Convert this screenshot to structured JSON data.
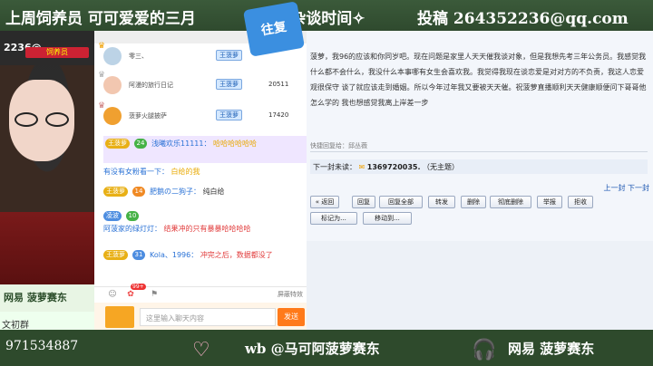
{
  "banner": {
    "left": "上周饲养员 可可爱爱的三月",
    "middle": "✧夜话杂谈时间✧",
    "right": "投稿 264352236@qq.com"
  },
  "webcam": {
    "overlay_text": "2236@",
    "badge": "饲养员",
    "strip_text": "网易 菠萝赛东",
    "bottom_text": "文初群"
  },
  "chat": {
    "ranking": [
      {
        "name": "零三、",
        "badge": "王菠萝",
        "score": ""
      },
      {
        "name": "阿漫的旅行日记",
        "badge": "王菠萝",
        "score": "20511"
      },
      {
        "name": "菠萝火腿披萨",
        "badge": "王菠萝",
        "score": "17420"
      }
    ],
    "messages": [
      {
        "level": "王菠萝",
        "rank": "24",
        "nick": "浅曦欢乐11111：",
        "text": "哈哈哈哈哈哈"
      },
      {
        "system": "有没有女粉看一下：",
        "text": "白给的我"
      },
      {
        "level": "王菠萝",
        "rank": "14",
        "nick": "肥鹅の二狗子：",
        "text": "纯白给"
      },
      {
        "level": "凌波",
        "rank": "10",
        "nick": "阿菠家的绿灯灯：",
        "text": "结果冲的只有暴暴哈哈哈哈"
      },
      {
        "level": "王菠萝",
        "rank": "31",
        "nick": "Kola、1996：",
        "text": "冲完之后，数据都没了"
      }
    ],
    "tools": [
      "emoji-icon",
      "gift-icon",
      "pin-icon"
    ],
    "gift_count": "99+",
    "shield_label": "屏蔽特效",
    "input_placeholder": "这里输入聊天内容",
    "send_label": "发送"
  },
  "logo": {
    "text": "往复"
  },
  "email": {
    "body": "菠萝，我96的应该和你同岁吧。现在问题是家里人天天催我谈对象，但是我想先考三年公务员。我感觉我什么都不会什么，我没什么本事哪有女生会喜欢我。我觉得我现在谈恋爱是对对方的不负责，我这人恋爱观很保守 谈了就应该走到婚姻。所以今年过年我又要被天天催。祝菠萝直播顺利天天健康顺便问下哥哥他怎么学的 我也想感觉我离上岸差一步",
    "reply_field": "快捷回复给：邱丛薇",
    "next_label": "下一封未读：",
    "next_addr": "1369720035.",
    "next_subject": "（无主题）",
    "page_links": "上一封  下一封",
    "buttons": [
      "« 返回",
      "回复",
      "回复全部",
      "转发",
      "删除",
      "彻底删除",
      "举报",
      "拒收"
    ],
    "dropdowns": [
      "标记为...",
      "移动到..."
    ]
  },
  "bottom": {
    "id": "971534887",
    "weibo": "wb @马可阿菠萝赛东",
    "wangyi": "网易 菠萝赛东"
  }
}
